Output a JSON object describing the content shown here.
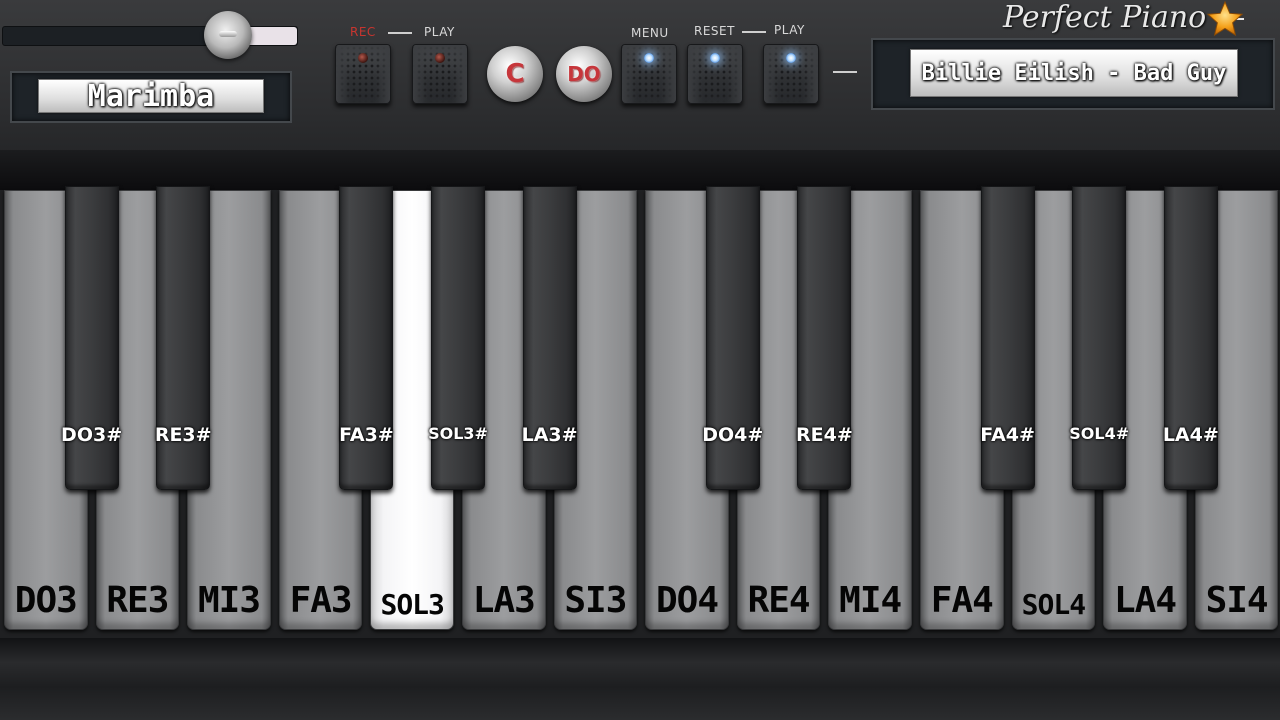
{
  "app": {
    "brand": "Perfect Piano",
    "accent_color": "#c6363b",
    "star_color": "#f5a11a"
  },
  "volume": {
    "level": 0.77
  },
  "instrument": {
    "name": "Marimba"
  },
  "controls": {
    "rec_caption": "REC",
    "play_caption": "PLAY",
    "menu_caption": "MENU",
    "reset_caption": "RESET",
    "play2_caption": "PLAY",
    "c_label": "C",
    "do_label": "DO",
    "icons": [
      "record-led-icon",
      "play-led-icon",
      "menu-led-icon",
      "reset-led-icon",
      "play-led-icon"
    ]
  },
  "song": {
    "title": "Billie Eilish - Bad Guy"
  },
  "keyboard": {
    "white_keys": [
      "DO3",
      "RE3",
      "MI3",
      "FA3",
      "SOL3",
      "LA3",
      "SI3",
      "DO4",
      "RE4",
      "MI4",
      "FA4",
      "SOL4",
      "LA4",
      "SI4"
    ],
    "black_keys": [
      "DO3#",
      "RE3#",
      "FA3#",
      "SOL3#",
      "LA3#",
      "DO4#",
      "RE4#",
      "FA4#",
      "SOL4#",
      "LA4#"
    ],
    "pressed_key": "SOL3"
  }
}
